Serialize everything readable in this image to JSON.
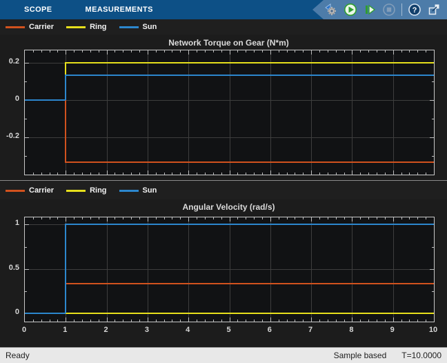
{
  "toolbar": {
    "tabs": [
      {
        "label": "SCOPE"
      },
      {
        "label": "MEASUREMENTS"
      }
    ],
    "buttons": {
      "settings": "Settings",
      "run": "Run",
      "step_forward": "Step Forward",
      "stop": "Stop",
      "help": "Help",
      "dock": "Dock"
    },
    "colors": {
      "bar": "#0D5086",
      "panel": "#4D7CA9"
    }
  },
  "legend": {
    "items": [
      {
        "label": "Carrier",
        "color": "#D2521E"
      },
      {
        "label": "Ring",
        "color": "#E7E01C"
      },
      {
        "label": "Sun",
        "color": "#2C87CE"
      }
    ]
  },
  "chart_data": [
    {
      "type": "line",
      "title": "Network Torque on Gear (N*m)",
      "xlabel": "",
      "ylabel": "",
      "xlim": [
        0,
        10
      ],
      "ylim": [
        -0.4,
        0.2667
      ],
      "xticks": [
        0,
        1,
        2,
        3,
        4,
        5,
        6,
        7,
        8,
        9,
        10
      ],
      "show_xlabels": false,
      "yticks": [
        {
          "value": 0.2,
          "label": "0.2"
        },
        {
          "value": 0,
          "label": "0"
        },
        {
          "value": -0.2,
          "label": "-0.2"
        }
      ],
      "yminor": [
        0.1,
        -0.1,
        -0.3
      ],
      "grid": true,
      "step_time": 1,
      "series": [
        {
          "name": "Carrier",
          "color": "#D2521E",
          "initial": 0,
          "final": -0.334
        },
        {
          "name": "Ring",
          "color": "#E7E01C",
          "initial": 0,
          "final": 0.2
        },
        {
          "name": "Sun",
          "color": "#2C87CE",
          "initial": 0,
          "final": 0.134
        }
      ]
    },
    {
      "type": "line",
      "title": "Angular Velocity (rad/s)",
      "xlabel": "",
      "ylabel": "",
      "xlim": [
        0,
        10
      ],
      "ylim": [
        -0.09,
        1.08
      ],
      "xticks": [
        0,
        1,
        2,
        3,
        4,
        5,
        6,
        7,
        8,
        9,
        10
      ],
      "show_xlabels": true,
      "yticks": [
        {
          "value": 1,
          "label": "1"
        },
        {
          "value": 0.5,
          "label": "0.5"
        },
        {
          "value": 0,
          "label": "0"
        }
      ],
      "yminor": [
        0.75,
        0.25
      ],
      "grid": true,
      "step_time": 1,
      "series": [
        {
          "name": "Carrier",
          "color": "#D2521E",
          "initial": 0,
          "final": 0.333
        },
        {
          "name": "Ring",
          "color": "#E7E01C",
          "initial": 0,
          "final": 0
        },
        {
          "name": "Sun",
          "color": "#2C87CE",
          "initial": 0,
          "final": 1
        }
      ]
    }
  ],
  "status_bar": {
    "left": "Ready",
    "middle": "Sample based",
    "right": "T=10.0000"
  }
}
